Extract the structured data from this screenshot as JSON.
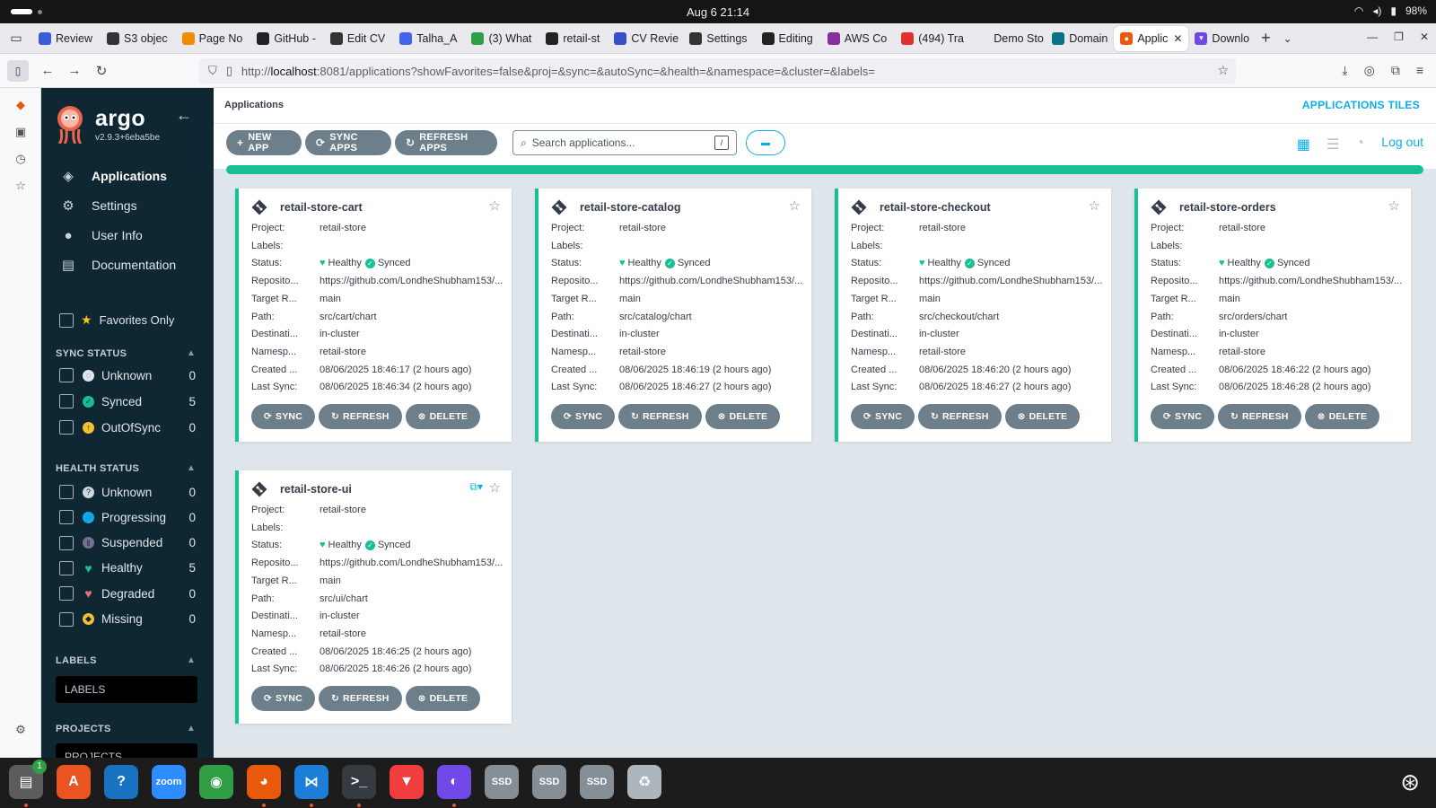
{
  "system": {
    "clock": "Aug 6  21:14",
    "battery": "98%"
  },
  "browser": {
    "tabs": [
      {
        "label": "Review",
        "icon": "tb-icon",
        "color": "#3b5bdb"
      },
      {
        "label": "S3 objec",
        "icon": "s3-icon",
        "color": "#333333"
      },
      {
        "label": "Page No",
        "icon": "box-icon",
        "color": "#f08c00"
      },
      {
        "label": "GitHub -",
        "icon": "github-icon",
        "color": "#222222"
      },
      {
        "label": "Edit CV",
        "icon": "edit-icon",
        "color": "#333333"
      },
      {
        "label": "Talha_A",
        "icon": "doc-icon",
        "color": "#4263eb"
      },
      {
        "label": "(3) What",
        "icon": "whatsapp-icon",
        "color": "#2f9e44"
      },
      {
        "label": "retail-st",
        "icon": "github-icon",
        "color": "#222222"
      },
      {
        "label": "CV Revie",
        "icon": "cv-icon",
        "color": "#364fc7"
      },
      {
        "label": "Settings",
        "icon": "gear-icon",
        "color": "#333333"
      },
      {
        "label": "Editing",
        "icon": "github-icon",
        "color": "#222222"
      },
      {
        "label": "AWS Co",
        "icon": "aws-icon",
        "color": "#862e9c"
      },
      {
        "label": "(494) Tra",
        "icon": "youtube-icon",
        "color": "#e03131"
      },
      {
        "label": "Demo Store",
        "icon": "blank-icon",
        "color": "#e9e9ee"
      },
      {
        "label": "Domain",
        "icon": "domain-icon",
        "color": "#0b7285"
      }
    ],
    "active_tab": {
      "label": "Applic",
      "color": "#e8590c"
    },
    "after_tab": {
      "label": "Downlo",
      "color": "#7048e8"
    },
    "url_prefix": "http://",
    "url_host": "localhost",
    "url_rest": ":8081/applications?showFavorites=false&proj=&sync=&autoSync=&health=&namespace=&cluster=&labels="
  },
  "sidebar": {
    "brand": "argo",
    "version": "v2.9.3+6eba5be",
    "menu": [
      {
        "label": "Applications",
        "icon": "layers-icon",
        "active": true
      },
      {
        "label": "Settings",
        "icon": "gears-icon",
        "active": false
      },
      {
        "label": "User Info",
        "icon": "user-icon",
        "active": false
      },
      {
        "label": "Documentation",
        "icon": "book-icon",
        "active": false
      }
    ],
    "favorites_label": "Favorites Only",
    "sync_title": "SYNC STATUS",
    "sync": [
      {
        "label": "Unknown",
        "count": "0",
        "color": "#dee6eb",
        "icon": "circle-notch-icon"
      },
      {
        "label": "Synced",
        "count": "5",
        "color": "#18be94",
        "icon": "check-circle-icon"
      },
      {
        "label": "OutOfSync",
        "count": "0",
        "color": "#f4c030",
        "icon": "arrow-up-circle-icon"
      }
    ],
    "health_title": "HEALTH STATUS",
    "health": [
      {
        "label": "Unknown",
        "count": "0",
        "color": "#ccd6dd",
        "icon": "question-circle-icon"
      },
      {
        "label": "Progressing",
        "count": "0",
        "color": "#0dadea",
        "icon": "circle-notch-icon"
      },
      {
        "label": "Suspended",
        "count": "0",
        "color": "#766f94",
        "icon": "pause-circle-icon"
      },
      {
        "label": "Healthy",
        "count": "5",
        "color": "#18be94",
        "icon": "heart-icon"
      },
      {
        "label": "Degraded",
        "count": "0",
        "color": "#e96d76",
        "icon": "heart-broken-icon"
      },
      {
        "label": "Missing",
        "count": "0",
        "color": "#f4c030",
        "icon": "ghost-icon"
      }
    ],
    "labels_title": "LABELS",
    "labels_placeholder": "LABELS",
    "projects_title": "PROJECTS",
    "projects_placeholder": "PROJECTS"
  },
  "header": {
    "breadcrumb": "Applications",
    "view_title": "APPLICATIONS TILES",
    "logout": "Log out"
  },
  "toolbar": {
    "new_app": "NEW APP",
    "sync_apps": "SYNC APPS",
    "refresh_apps": "REFRESH APPS",
    "search_placeholder": "Search applications...",
    "search_shortcut": "/"
  },
  "sync_progress": 1.0,
  "field_labels": {
    "project": "Project:",
    "labels": "Labels:",
    "status": "Status:",
    "repo": "Reposito...",
    "target": "Target R...",
    "path": "Path:",
    "destination": "Destinati...",
    "namespace": "Namesp...",
    "created": "Created ...",
    "last_sync": "Last Sync:"
  },
  "card_buttons": {
    "sync": "SYNC",
    "refresh": "REFRESH",
    "delete": "DELETE"
  },
  "applications": [
    {
      "name": "retail-store-cart",
      "project": "retail-store",
      "labels": "",
      "health": "Healthy",
      "sync": "Synced",
      "repo": "https://github.com/LondheShubham153/...",
      "target": "main",
      "path": "src/cart/chart",
      "destination": "in-cluster",
      "namespace": "retail-store",
      "created": "08/06/2025 18:46:17  (2 hours ago)",
      "last_sync": "08/06/2025 18:46:34  (2 hours ago)"
    },
    {
      "name": "retail-store-catalog",
      "project": "retail-store",
      "labels": "",
      "health": "Healthy",
      "sync": "Synced",
      "repo": "https://github.com/LondheShubham153/...",
      "target": "main",
      "path": "src/catalog/chart",
      "destination": "in-cluster",
      "namespace": "retail-store",
      "created": "08/06/2025 18:46:19  (2 hours ago)",
      "last_sync": "08/06/2025 18:46:27  (2 hours ago)"
    },
    {
      "name": "retail-store-checkout",
      "project": "retail-store",
      "labels": "",
      "health": "Healthy",
      "sync": "Synced",
      "repo": "https://github.com/LondheShubham153/...",
      "target": "main",
      "path": "src/checkout/chart",
      "destination": "in-cluster",
      "namespace": "retail-store",
      "created": "08/06/2025 18:46:20  (2 hours ago)",
      "last_sync": "08/06/2025 18:46:27  (2 hours ago)"
    },
    {
      "name": "retail-store-orders",
      "project": "retail-store",
      "labels": "",
      "health": "Healthy",
      "sync": "Synced",
      "repo": "https://github.com/LondheShubham153/...",
      "target": "main",
      "path": "src/orders/chart",
      "destination": "in-cluster",
      "namespace": "retail-store",
      "created": "08/06/2025 18:46:22  (2 hours ago)",
      "last_sync": "08/06/2025 18:46:28  (2 hours ago)"
    },
    {
      "name": "retail-store-ui",
      "project": "retail-store",
      "labels": "",
      "health": "Healthy",
      "sync": "Synced",
      "repo": "https://github.com/LondheShubham153/...",
      "target": "main",
      "path": "src/ui/chart",
      "destination": "in-cluster",
      "namespace": "retail-store",
      "created": "08/06/2025 18:46:25  (2 hours ago)",
      "last_sync": "08/06/2025 18:46:26  (2 hours ago)",
      "has_link": true
    }
  ],
  "dock": [
    {
      "name": "files-app",
      "color": "#5c5c5c",
      "glyph": "▤",
      "badge": "1",
      "running": true
    },
    {
      "name": "app-center",
      "color": "#e95420",
      "glyph": "A",
      "running": false
    },
    {
      "name": "help-app",
      "color": "#1971c2",
      "glyph": "?",
      "running": false
    },
    {
      "name": "zoom-app",
      "color": "#2d8cff",
      "glyph": "zoom",
      "running": false
    },
    {
      "name": "chrome-app",
      "color": "#2f9e44",
      "glyph": "◉",
      "running": false
    },
    {
      "name": "firefox-app",
      "color": "#e8590c",
      "glyph": "◕",
      "running": true
    },
    {
      "name": "vscode-app",
      "color": "#1c7ed6",
      "glyph": "⋈",
      "running": true
    },
    {
      "name": "terminal-app",
      "color": "#343a40",
      "glyph": ">_",
      "running": true
    },
    {
      "name": "brave-app",
      "color": "#f03e3e",
      "glyph": "▼",
      "running": false
    },
    {
      "name": "ghost-app",
      "color": "#7048e8",
      "glyph": "◐",
      "running": true
    },
    {
      "name": "ssd-drive-1",
      "color": "#868e96",
      "glyph": "SSD",
      "running": false
    },
    {
      "name": "ssd-drive-2",
      "color": "#868e96",
      "glyph": "SSD",
      "running": false
    },
    {
      "name": "ssd-drive-3",
      "color": "#868e96",
      "glyph": "SSD",
      "running": false
    },
    {
      "name": "trash-app",
      "color": "#adb5bd",
      "glyph": "♻",
      "running": false
    }
  ]
}
